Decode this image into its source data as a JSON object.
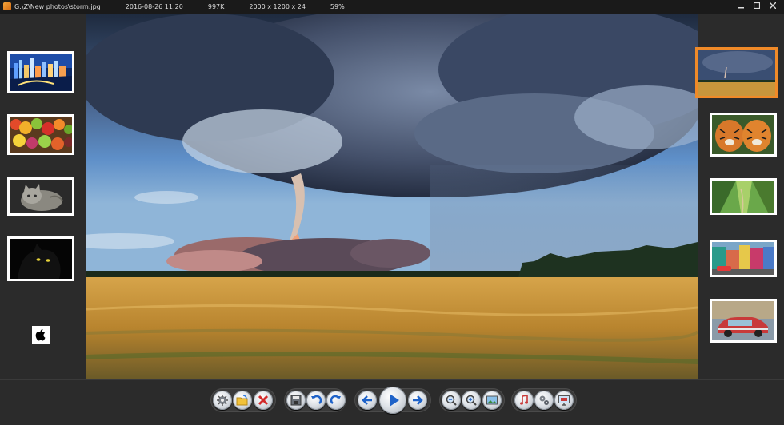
{
  "window": {
    "path": "G:\\Z\\New photos\\storm.jpg",
    "datetime": "2016-08-26 11:20",
    "filesize": "997K",
    "dimensions": "2000 x 1200 x 24",
    "zoom": "59%",
    "controls": [
      "minimize",
      "maximize",
      "close"
    ]
  },
  "left_thumbnails": [
    "city-night",
    "market-fruits",
    "kitten",
    "black-cat",
    "apple-logo"
  ],
  "right_thumbnails": [
    "storm-field",
    "tigers",
    "green-valley",
    "colorful-street",
    "vintage-car"
  ],
  "selected_thumbnail": "storm-field",
  "toolbar": {
    "buttons": [
      "settings",
      "open-folder",
      "delete",
      "save",
      "undo",
      "redo",
      "previous",
      "play",
      "next",
      "zoom-out",
      "zoom-in",
      "fit-image",
      "music",
      "gears",
      "slideshow-screen"
    ]
  }
}
